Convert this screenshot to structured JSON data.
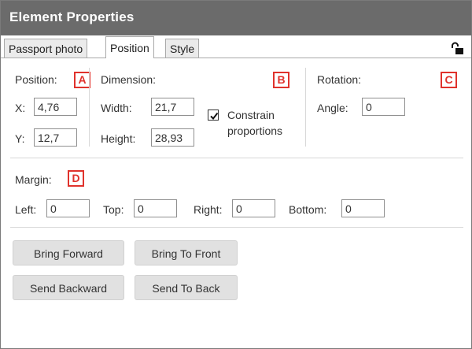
{
  "window": {
    "title": "Element Properties"
  },
  "tabs": [
    {
      "label": "Passport photo",
      "active": false
    },
    {
      "label": "Position",
      "active": true
    },
    {
      "label": "Style",
      "active": false
    }
  ],
  "icons": {
    "lock": "unlock-icon"
  },
  "position": {
    "heading": "Position:",
    "badge": "A",
    "x_label": "X:",
    "x_value": "4,76",
    "y_label": "Y:",
    "y_value": "12,7"
  },
  "dimension": {
    "heading": "Dimension:",
    "badge": "B",
    "width_label": "Width:",
    "width_value": "21,7",
    "height_label": "Height:",
    "height_value": "28,93",
    "constrain_line1": "Constrain",
    "constrain_line2": "proportions",
    "constrain_checked": true
  },
  "rotation": {
    "heading": "Rotation:",
    "badge": "C",
    "angle_label": "Angle:",
    "angle_value": "0"
  },
  "margin": {
    "heading": "Margin:",
    "badge": "D",
    "left_label": "Left:",
    "left_value": "0",
    "top_label": "Top:",
    "top_value": "0",
    "right_label": "Right:",
    "right_value": "0",
    "bottom_label": "Bottom:",
    "bottom_value": "0"
  },
  "buttons": {
    "bring_forward": "Bring Forward",
    "bring_to_front": "Bring To Front",
    "send_backward": "Send Backward",
    "send_to_back": "Send To Back"
  },
  "colors": {
    "title_bar": "#6b6b6b",
    "badge": "#e0322c",
    "button_bg": "#e1e1e1"
  }
}
